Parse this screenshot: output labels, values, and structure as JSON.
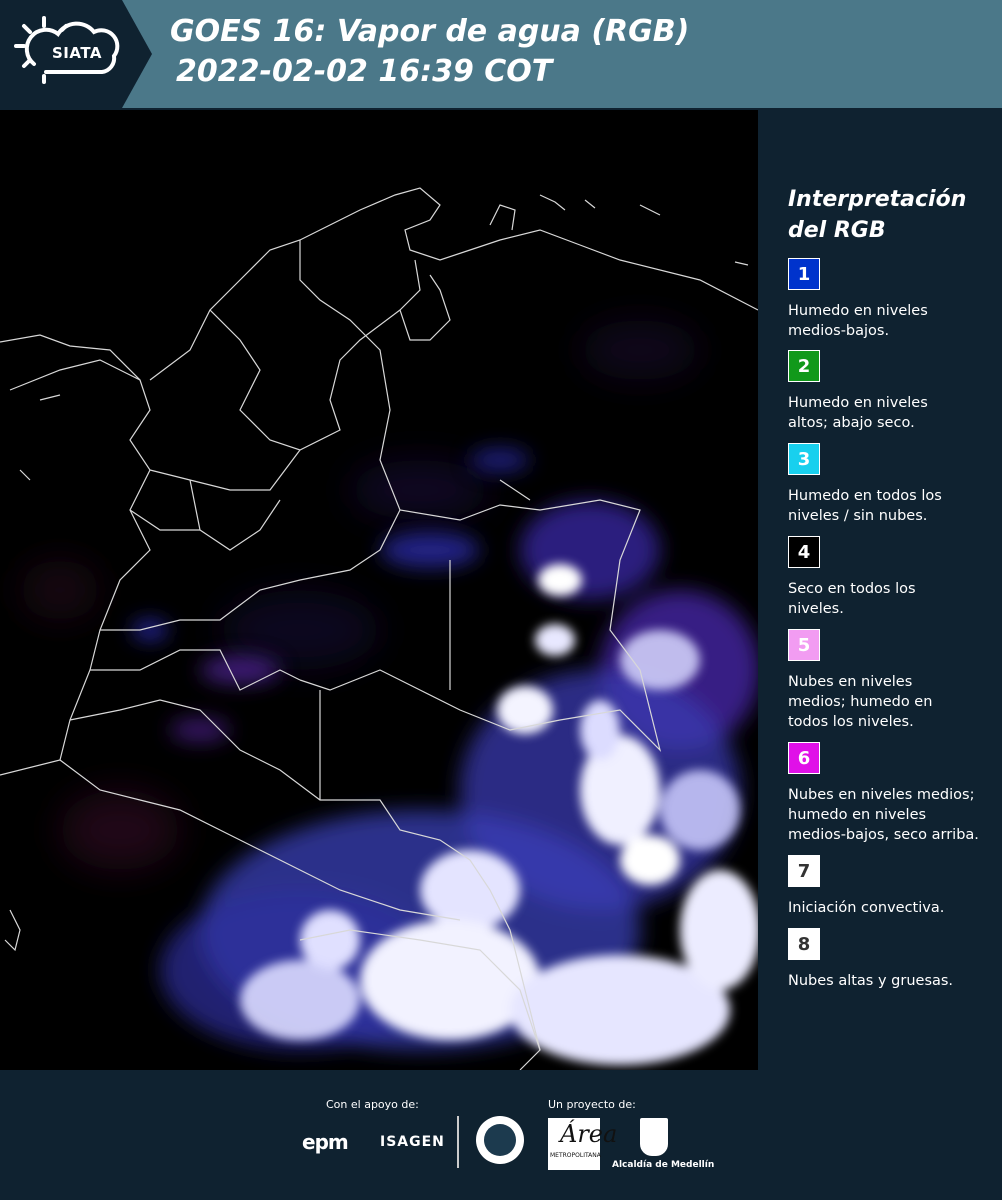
{
  "header": {
    "logo_text": "SIATA",
    "title_line1": "GOES 16: Vapor de agua (RGB)",
    "title_line2": "2022-02-02 16:39 COT"
  },
  "legend": {
    "title_line1": "Interpretación",
    "title_line2": "del RGB",
    "items": [
      {
        "number": "1",
        "color": "#0033cc",
        "number_color": "#ffffff",
        "desc_line1": "Humedo en niveles",
        "desc_line2": "medios-bajos.",
        "desc_line3": ""
      },
      {
        "number": "2",
        "color": "#11991a",
        "number_color": "#ffffff",
        "desc_line1": "Humedo en niveles",
        "desc_line2": "altos; abajo seco.",
        "desc_line3": ""
      },
      {
        "number": "3",
        "color": "#18d0ee",
        "number_color": "#ffffff",
        "desc_line1": "Humedo en todos los",
        "desc_line2": "niveles / sin nubes.",
        "desc_line3": ""
      },
      {
        "number": "4",
        "color": "#000000",
        "number_color": "#ffffff",
        "desc_line1": "Seco en todos los",
        "desc_line2": "niveles.",
        "desc_line3": ""
      },
      {
        "number": "5",
        "color": "#f29cf2",
        "number_color": "#ffffff",
        "desc_line1": "Nubes en niveles",
        "desc_line2": "medios; humedo en",
        "desc_line3": "todos los niveles."
      },
      {
        "number": "6",
        "color": "#e010e8",
        "number_color": "#ffffff",
        "desc_line1": "Nubes en niveles medios;",
        "desc_line2": "humedo en niveles",
        "desc_line3": "medios-bajos, seco arriba."
      },
      {
        "number": "7",
        "color": "#ffffff",
        "number_color": "#333333",
        "desc_line1": "Iniciación convectiva.",
        "desc_line2": "",
        "desc_line3": ""
      },
      {
        "number": "8",
        "color": "#ffffff",
        "number_color": "#333333",
        "desc_line1": "Nubes altas y gruesas.",
        "desc_line2": "",
        "desc_line3": ""
      }
    ]
  },
  "footer": {
    "support_label": "Con el apoyo de:",
    "project_label": "Un proyecto de:",
    "epm_logo": "epm",
    "isagen_logo": "ISAGEN",
    "amva_logo": "Área",
    "amva_subtext": "METROPOLITANA",
    "alcaldia_logo": "Alcaldía de Medellín"
  }
}
